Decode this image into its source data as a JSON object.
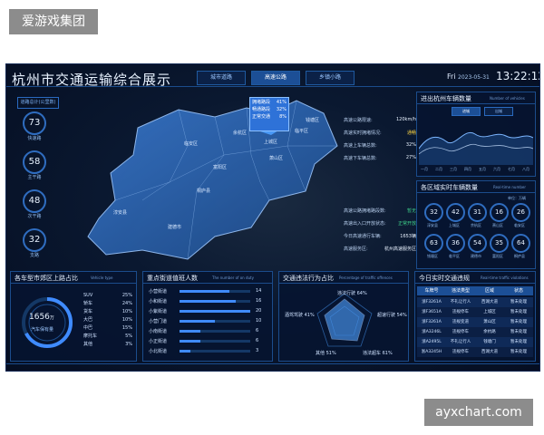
{
  "watermark_top": "爱游戏集团",
  "watermark_bottom": "ayxchart.com",
  "header": {
    "title": "杭州市交通运输综合展示",
    "tabs": [
      "城市道路",
      "高速公路",
      "乡镇小路"
    ],
    "active_tab": 1,
    "day": "Fri",
    "date": "2023-05-31",
    "time": "13:22:12"
  },
  "left_stats": {
    "tag": "道路总计(公里数)",
    "items": [
      {
        "value": "73",
        "label": "快速路"
      },
      {
        "value": "58",
        "label": "主干路"
      },
      {
        "value": "48",
        "label": "次干路"
      },
      {
        "value": "32",
        "label": "支路"
      }
    ]
  },
  "map": {
    "popup_rows": [
      {
        "label": "拥堵路段",
        "value": "41%"
      },
      {
        "label": "畅通路段",
        "value": "32%"
      },
      {
        "label": "正常交通",
        "value": "8%"
      }
    ],
    "labels": [
      "淳安县",
      "建德市",
      "桐庐县",
      "富阳区",
      "临安区",
      "余杭区",
      "上城区",
      "萧山区",
      "临平区",
      "钱塘区"
    ]
  },
  "mid_stats": [
    {
      "label": "高速公路限速:",
      "value": "120km/h"
    },
    {
      "label": "高速实时拥堵情况:",
      "value": "通畅"
    },
    {
      "label": "高速上车辆总数:",
      "value": "32%"
    },
    {
      "label": "高速下车辆总数:",
      "value": "27%"
    }
  ],
  "mid_stats2": [
    {
      "label": "高速公路拥堵路段数:",
      "value": "暂无"
    },
    {
      "label": "高速出入口开放状态:",
      "value": "正常开放"
    },
    {
      "label": "今日高速通行车辆:",
      "value": "1653辆"
    },
    {
      "label": "高速服务区:",
      "value": "杭州高速服务区"
    }
  ],
  "right_top": {
    "title": "进出杭州车辆数量",
    "subtitle": "Number of vehicles",
    "tabs": [
      "进城",
      "出城"
    ],
    "months": [
      "一月",
      "二月",
      "三月",
      "四月",
      "五月",
      "六月",
      "七月",
      "八月"
    ]
  },
  "right_mid": {
    "title": "各区域实时车辆数量",
    "subtitle": "Real-time number",
    "unit": "单位：万辆",
    "items": [
      {
        "value": "32",
        "label": "淳安县"
      },
      {
        "value": "42",
        "label": "上城区"
      },
      {
        "value": "31",
        "label": "余杭区"
      },
      {
        "value": "16",
        "label": "萧山区"
      },
      {
        "value": "26",
        "label": "临安区"
      },
      {
        "value": "63",
        "label": "钱塘区"
      },
      {
        "value": "36",
        "label": "临平区"
      },
      {
        "value": "54",
        "label": "建德市"
      },
      {
        "value": "35",
        "label": "富阳区"
      },
      {
        "value": "64",
        "label": "桐庐县"
      }
    ]
  },
  "bottom_left": {
    "title": "各车型市郊区上路占比",
    "subtitle": "Vehicle type",
    "center_value": "1656",
    "center_unit": "万",
    "center_label": "汽车保有量",
    "legend": [
      {
        "name": "SUV",
        "value": "25%"
      },
      {
        "name": "轿车",
        "value": "24%"
      },
      {
        "name": "货车",
        "value": "10%"
      },
      {
        "name": "大巴",
        "value": "10%"
      },
      {
        "name": "中巴",
        "value": "15%"
      },
      {
        "name": "摩托车",
        "value": "5%"
      },
      {
        "name": "其他",
        "value": "3%"
      }
    ]
  },
  "bottom_mid1": {
    "title": "重点街道值班人数",
    "subtitle": "The number of on duty",
    "rows": [
      {
        "name": "小营街道",
        "value": "14"
      },
      {
        "name": "小和街道",
        "value": "16"
      },
      {
        "name": "小紫街道",
        "value": "20"
      },
      {
        "name": "小营门道",
        "value": "10"
      },
      {
        "name": "小南街道",
        "value": "6"
      },
      {
        "name": "小正街道",
        "value": "6"
      },
      {
        "name": "小北街道",
        "value": "3"
      }
    ]
  },
  "bottom_mid2": {
    "title": "交通违法行为占比",
    "subtitle": "Percentage of traffic offences",
    "labels": [
      {
        "name": "违法行驶",
        "value": "64%"
      },
      {
        "name": "超速行驶",
        "value": "54%"
      },
      {
        "name": "违法超车",
        "value": "61%"
      },
      {
        "name": "其他",
        "value": "51%"
      },
      {
        "name": "酒驾驾驶",
        "value": "41%"
      }
    ]
  },
  "bottom_right": {
    "title": "今日实时交通违规",
    "subtitle": "Real-time traffic violations",
    "headers": [
      "车牌号",
      "违法类型",
      "区域",
      "状态"
    ],
    "rows": [
      [
        "浙F3261A",
        "不礼让行人",
        "西湖大道",
        "暂未处理"
      ],
      [
        "浙F3651A",
        "违规停车",
        "上城区",
        "暂未处理"
      ],
      [
        "浙F3261A",
        "违规变道",
        "萧山区",
        "暂未处理"
      ],
      [
        "浙A3246L",
        "违规停车",
        "余杭路",
        "暂未处理"
      ],
      [
        "浙A2495L",
        "不礼让行人",
        "钱塘门",
        "暂未处理"
      ],
      [
        "浙A3245H",
        "违规停车",
        "西湖大道",
        "暂未处理"
      ]
    ]
  },
  "colors": {
    "bg": "#06112a",
    "accent": "#2f6dc0",
    "map_fill": "#2a5e9e",
    "highlight": "#4ea0ff"
  }
}
